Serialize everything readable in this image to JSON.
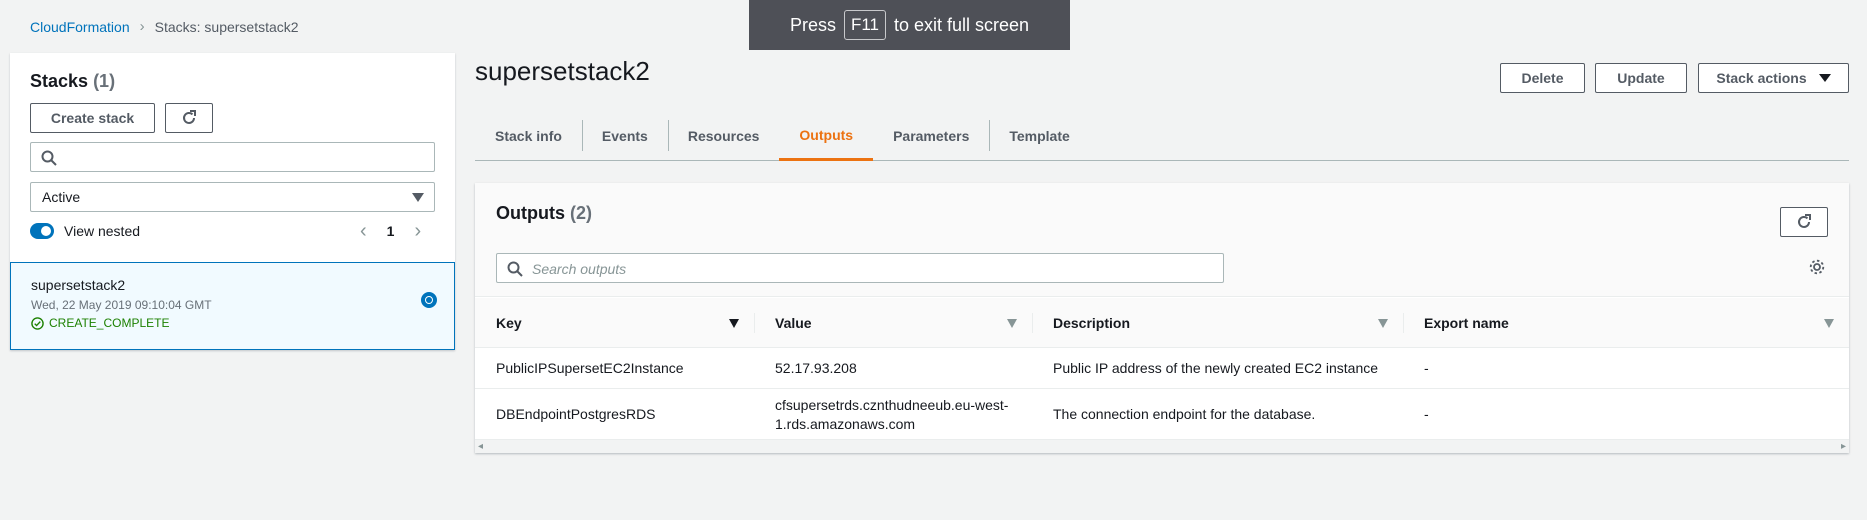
{
  "breadcrumb": {
    "root": "CloudFormation",
    "current": "Stacks: supersetstack2"
  },
  "fullscreen_banner": {
    "prefix": "Press",
    "key": "F11",
    "suffix": "to exit full screen"
  },
  "left": {
    "title": "Stacks",
    "count": "(1)",
    "create_label": "Create stack",
    "search_value": "",
    "filter_value": "Active",
    "view_nested_label": "View nested",
    "view_nested_on": true,
    "page": "1",
    "stacks": [
      {
        "name": "supersetstack2",
        "date": "Wed, 22 May 2019 09:10:04 GMT",
        "status": "CREATE_COMPLETE",
        "selected": true
      }
    ]
  },
  "main": {
    "title": "supersetstack2",
    "actions": {
      "delete": "Delete",
      "update": "Update",
      "stack_actions": "Stack actions"
    },
    "tabs": [
      "Stack info",
      "Events",
      "Resources",
      "Outputs",
      "Parameters",
      "Template"
    ],
    "active_tab": "Outputs"
  },
  "outputs": {
    "title": "Outputs",
    "count": "(2)",
    "search_placeholder": "Search outputs",
    "columns": [
      "Key",
      "Value",
      "Description",
      "Export name"
    ],
    "rows": [
      {
        "key": "PublicIPSupersetEC2Instance",
        "value": "52.17.93.208",
        "description": "Public IP address of the newly created EC2 instance",
        "export": "-"
      },
      {
        "key": "DBEndpointPostgresRDS",
        "value": "cfsupersetrds.cznthudneeub.eu-west-1.rds.amazonaws.com",
        "description": "The connection endpoint for the database.",
        "export": "-"
      }
    ]
  },
  "colors": {
    "link": "#0073bb",
    "active_tab": "#ec7211",
    "success": "#1d8102",
    "banner_bg": "#4e5057"
  }
}
